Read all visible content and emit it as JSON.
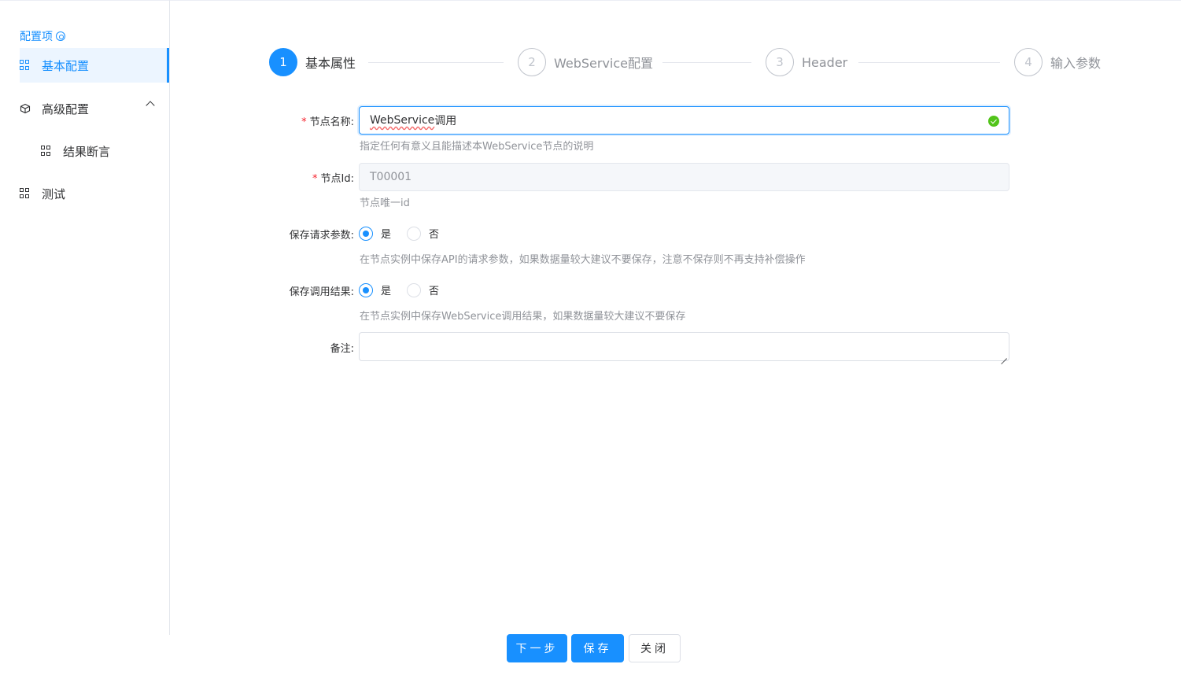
{
  "sidebar": {
    "title": "配置项",
    "items": [
      {
        "label": "基本配置"
      },
      {
        "label": "高级配置"
      },
      {
        "label": "结果断言"
      },
      {
        "label": "测试"
      }
    ]
  },
  "steps": [
    {
      "num": "1",
      "label": "基本属性"
    },
    {
      "num": "2",
      "label": "WebService配置"
    },
    {
      "num": "3",
      "label": "Header"
    },
    {
      "num": "4",
      "label": "输入参数"
    }
  ],
  "form": {
    "node_name": {
      "label": "节点名称:",
      "value_underlined": "WebService",
      "value_rest": "调用",
      "hint": "指定任何有意义且能描述本WebService节点的说明"
    },
    "node_id": {
      "label": "节点Id:",
      "value": "T00001",
      "hint": "节点唯一id"
    },
    "save_request_params": {
      "label": "保存请求参数:",
      "options": [
        "是",
        "否"
      ],
      "selected": "是",
      "hint": "在节点实例中保存API的请求参数，如果数据量较大建议不要保存，注意不保存则不再支持补偿操作"
    },
    "save_call_result": {
      "label": "保存调用结果:",
      "options": [
        "是",
        "否"
      ],
      "selected": "是",
      "hint": "在节点实例中保存WebService调用结果，如果数据量较大建议不要保存"
    },
    "remark": {
      "label": "备注:",
      "value": ""
    }
  },
  "footer": {
    "next_label": "下一步",
    "save_label": "保存",
    "close_label": "关闭"
  },
  "colors": {
    "primary": "#1890ff",
    "required": "#f5222d",
    "success": "#52c41a"
  }
}
